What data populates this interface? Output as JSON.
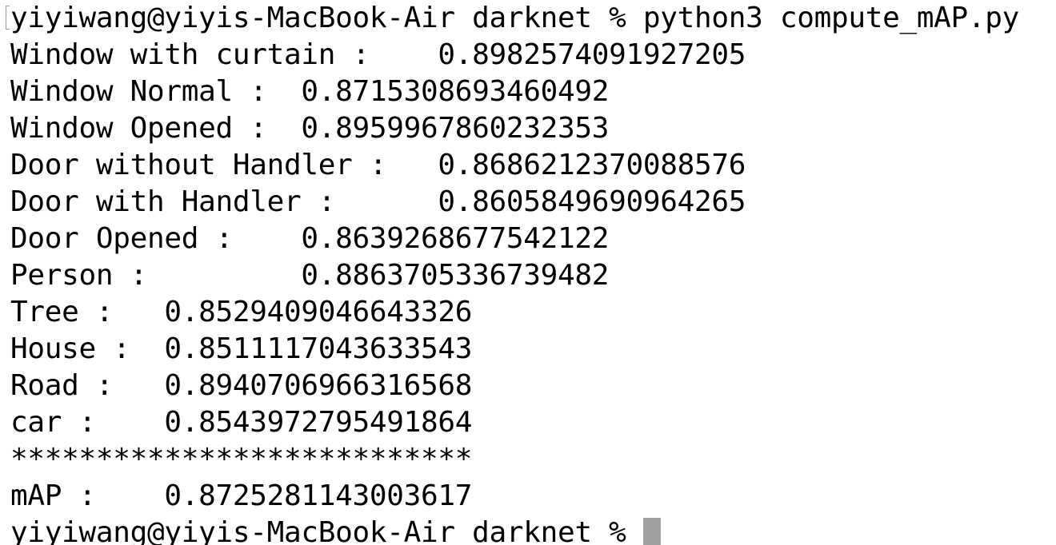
{
  "terminal": {
    "command_line": "yiyiwang@yiyis-MacBook-Air darknet % python3 compute_mAP.py",
    "results": [
      {
        "label": "Window with curtain :    ",
        "value": "0.8982574091927205"
      },
      {
        "label": "Window Normal :  ",
        "value": "0.8715308693460492"
      },
      {
        "label": "Window Opened :  ",
        "value": "0.8959967860232353"
      },
      {
        "label": "Door without Handler :   ",
        "value": "0.8686212370088576"
      },
      {
        "label": "Door with Handler :      ",
        "value": "0.8605849690964265"
      },
      {
        "label": "Door Opened :    ",
        "value": "0.8639268677542122"
      },
      {
        "label": "Person :         ",
        "value": "0.8863705336739482"
      },
      {
        "label": "Tree :   ",
        "value": "0.8529409046643326"
      },
      {
        "label": "House :  ",
        "value": "0.8511117043633543"
      },
      {
        "label": "Road :   ",
        "value": "0.8940706966316568"
      },
      {
        "label": "car :    ",
        "value": "0.8543972795491864"
      }
    ],
    "separator": "***************************",
    "summary": {
      "label": "mAP :    ",
      "value": "0.8725281143003617"
    },
    "prompt": "yiyiwang@yiyis-MacBook-Air darknet % "
  }
}
